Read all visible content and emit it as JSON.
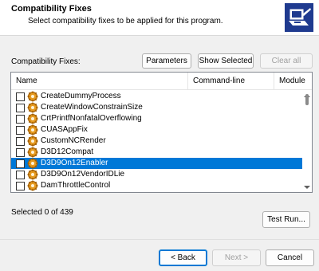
{
  "header": {
    "title": "Compatibility Fixes",
    "subtitle": "Select compatibility fixes to be applied for this program."
  },
  "section_label": "Compatibility Fixes:",
  "toolbar": {
    "parameters_label": "Parameters",
    "show_selected_label": "Show Selected",
    "clear_all_label": "Clear all"
  },
  "list": {
    "columns": [
      "Name",
      "Command-line",
      "Module"
    ],
    "rows": [
      {
        "name": "CreateDummyProcess",
        "checked": false,
        "selected": false
      },
      {
        "name": "CreateWindowConstrainSize",
        "checked": false,
        "selected": false
      },
      {
        "name": "CrtPrintfNonfatalOverflowing",
        "checked": false,
        "selected": false
      },
      {
        "name": "CUASAppFix",
        "checked": false,
        "selected": false
      },
      {
        "name": "CustomNCRender",
        "checked": false,
        "selected": false
      },
      {
        "name": "D3D12Compat",
        "checked": false,
        "selected": false
      },
      {
        "name": "D3D9On12Enabler",
        "checked": false,
        "selected": true
      },
      {
        "name": "D3D9On12VendorIDLie",
        "checked": false,
        "selected": false
      },
      {
        "name": "DamThrottleControl",
        "checked": false,
        "selected": false
      }
    ]
  },
  "status": {
    "selected_text": "Selected 0 of 439"
  },
  "buttons": {
    "test_run_label": "Test Run...",
    "back_label": "< Back",
    "next_label": "Next >",
    "cancel_label": "Cancel"
  },
  "colors": {
    "selection": "#0078d7",
    "background": "#f0f0f0",
    "focus_border": "#0078d4"
  }
}
